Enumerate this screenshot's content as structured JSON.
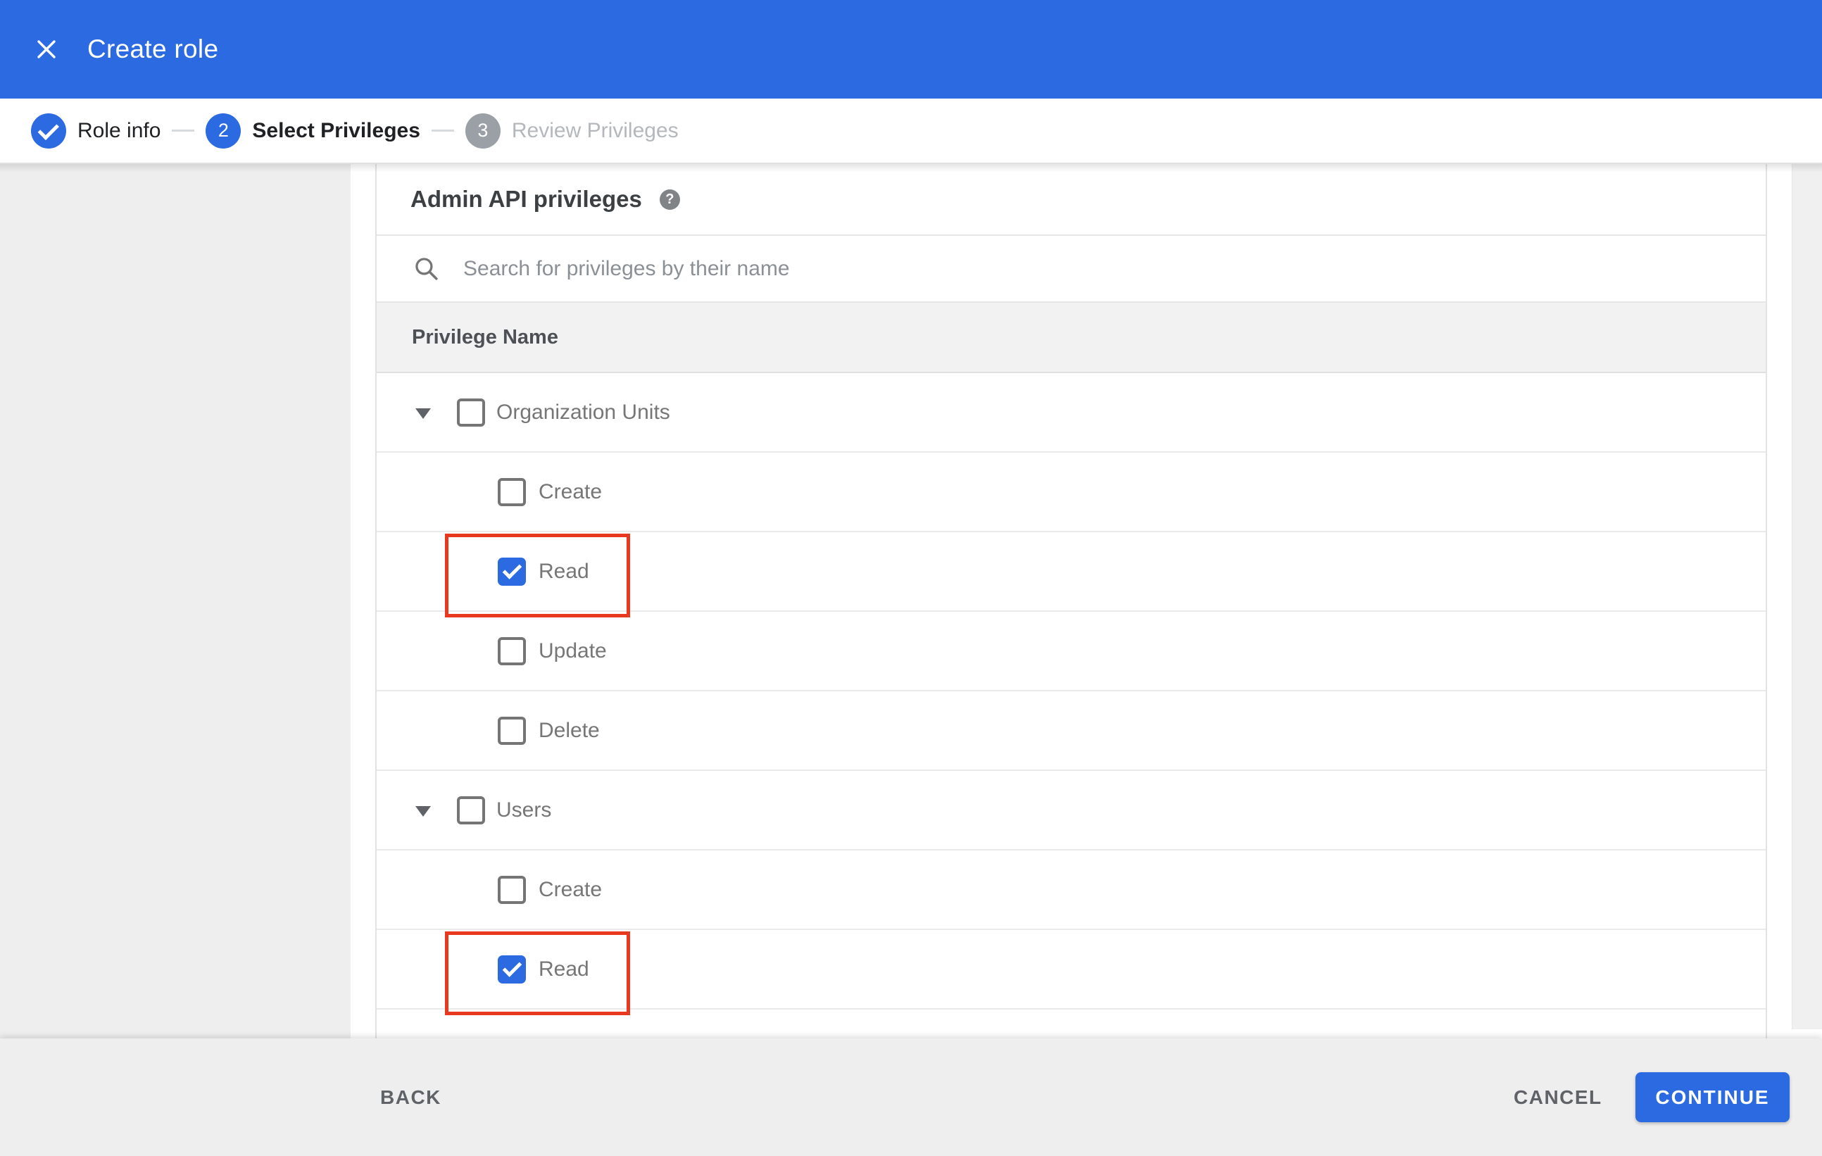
{
  "colors": {
    "accent": "#2b6ae0",
    "highlight_red": "#e8391f",
    "footer_bg": "#eeeeee",
    "sidebar_bg": "#eeeeee",
    "table_header_bg": "#f2f2f2",
    "step_inactive_gray": "#9aa0a6"
  },
  "header": {
    "title": "Create role",
    "close_icon": "close-x"
  },
  "stepper": [
    {
      "id": "1",
      "label": "Role info",
      "state": "complete",
      "icon": "check-icon"
    },
    {
      "id": "2",
      "label": "Select Privileges",
      "state": "active"
    },
    {
      "id": "3",
      "label": "Review Privileges",
      "state": "upcoming"
    }
  ],
  "panel": {
    "heading": "Admin API privileges",
    "help_icon": "?",
    "search": {
      "placeholder": "Search for privileges by their name",
      "value": "",
      "icon": "search-icon"
    },
    "table": {
      "column_header": "Privilege Name",
      "rows": [
        {
          "type": "group",
          "label": "Organization Units",
          "checked": false,
          "expanded": true,
          "highlighted": false
        },
        {
          "type": "child",
          "label": "Create",
          "checked": false,
          "highlighted": false
        },
        {
          "type": "child",
          "label": "Read",
          "checked": true,
          "highlighted": true
        },
        {
          "type": "child",
          "label": "Update",
          "checked": false,
          "highlighted": false
        },
        {
          "type": "child",
          "label": "Delete",
          "checked": false,
          "highlighted": false
        },
        {
          "type": "group",
          "label": "Users",
          "checked": false,
          "expanded": true,
          "highlighted": false
        },
        {
          "type": "child",
          "label": "Create",
          "checked": false,
          "highlighted": false
        },
        {
          "type": "child",
          "label": "Read",
          "checked": true,
          "highlighted": true
        }
      ]
    }
  },
  "footer": {
    "back_label": "BACK",
    "cancel_label": "CANCEL",
    "continue_label": "CONTINUE"
  }
}
